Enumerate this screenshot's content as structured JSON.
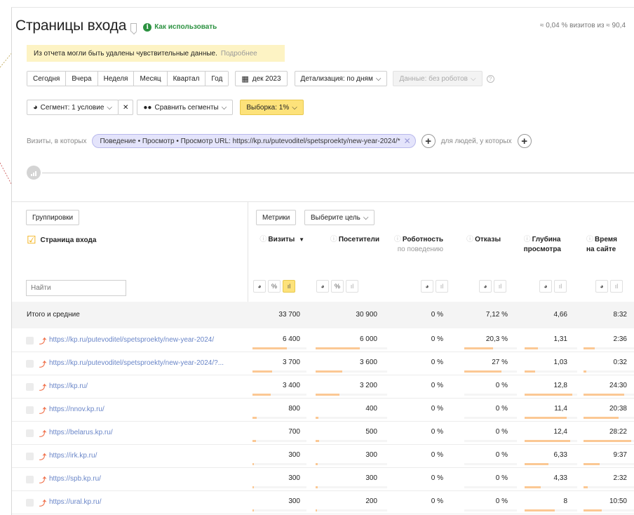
{
  "header": {
    "title": "Страницы входа",
    "howto_label": "Как использовать",
    "visits_ratio": "≈ 0,04 % визитов из ≈ 90,4"
  },
  "warning": {
    "text": "Из отчета могли быть удалены чувствительные данные.",
    "more_label": "Подробнее"
  },
  "period": {
    "buttons": [
      "Сегодня",
      "Вчера",
      "Неделя",
      "Месяц",
      "Квартал",
      "Год"
    ],
    "date_label": "дек 2023",
    "detail_label": "Детализация: по дням",
    "data_label": "Данные: без роботов"
  },
  "segment": {
    "segment_label": "Сегмент: 1 условие",
    "compare_label": "Сравнить сегменты",
    "sample_label": "Выборка: 1%"
  },
  "filter": {
    "prefix": "Визиты, в которых",
    "chip": "Поведение • Просмотр • Просмотр URL: https://kp.ru/putevoditel/spetsproekty/new-year-2024/*",
    "people_label": "для людей, у которых"
  },
  "table": {
    "group_label": "Группировки",
    "metrics_label": "Метрики",
    "goal_label": "Выберите цель",
    "dimension_label": "Страница входа",
    "search_placeholder": "Найти",
    "columns": [
      {
        "title": "Визиты",
        "sort": "▼",
        "sub": ""
      },
      {
        "title": "Посетители",
        "sub": ""
      },
      {
        "title": "Роботность",
        "sub": "по поведению"
      },
      {
        "title": "Отказы",
        "sub": ""
      },
      {
        "title": "Глубина",
        "title2": "просмотра",
        "sub": ""
      },
      {
        "title": "Время",
        "title2": "на сайте",
        "sub": ""
      }
    ],
    "totals": {
      "label": "Итого и средние",
      "values": [
        "33 700",
        "30 900",
        "0 %",
        "7,12 %",
        "4,66",
        "8:32"
      ]
    },
    "rows": [
      {
        "url": "https://kp.ru/putevoditel/spetsproekty/new-year-2024/",
        "values": [
          "6 400",
          "6 000",
          "0 %",
          "20,3 %",
          "1,31",
          "2:36"
        ],
        "bars": [
          0.64,
          0.62,
          0,
          0.55,
          0.25,
          0.22
        ]
      },
      {
        "url": "https://kp.ru/putevoditel/spetsproekty/new-year-2024/?...",
        "values": [
          "3 700",
          "3 600",
          "0 %",
          "27 %",
          "1,03",
          "0:32"
        ],
        "bars": [
          0.37,
          0.37,
          0,
          0.7,
          0.2,
          0.05
        ]
      },
      {
        "url": "https://kp.ru/",
        "values": [
          "3 400",
          "3 200",
          "0 %",
          "0 %",
          "12,8",
          "24:30"
        ],
        "bars": [
          0.34,
          0.33,
          0,
          0,
          0.9,
          0.8
        ]
      },
      {
        "url": "https://nnov.kp.ru/",
        "values": [
          "800",
          "400",
          "0 %",
          "0 %",
          "11,4",
          "20:38"
        ],
        "bars": [
          0.08,
          0.04,
          0,
          0,
          0.8,
          0.7
        ]
      },
      {
        "url": "https://belarus.kp.ru/",
        "values": [
          "700",
          "500",
          "0 %",
          "0 %",
          "12,4",
          "28:22"
        ],
        "bars": [
          0.07,
          0.05,
          0,
          0,
          0.87,
          0.95
        ]
      },
      {
        "url": "https://irk.kp.ru/",
        "values": [
          "300",
          "300",
          "0 %",
          "0 %",
          "6,33",
          "9:37"
        ],
        "bars": [
          0.03,
          0.03,
          0,
          0,
          0.45,
          0.32
        ]
      },
      {
        "url": "https://spb.kp.ru/",
        "values": [
          "300",
          "300",
          "0 %",
          "0 %",
          "4,33",
          "2:32"
        ],
        "bars": [
          0.03,
          0.03,
          0,
          0,
          0.3,
          0.08
        ]
      },
      {
        "url": "https://ural.kp.ru/",
        "values": [
          "300",
          "200",
          "0 %",
          "0 %",
          "8",
          "10:50"
        ],
        "bars": [
          0.03,
          0.02,
          0,
          0,
          0.57,
          0.36
        ]
      }
    ]
  }
}
